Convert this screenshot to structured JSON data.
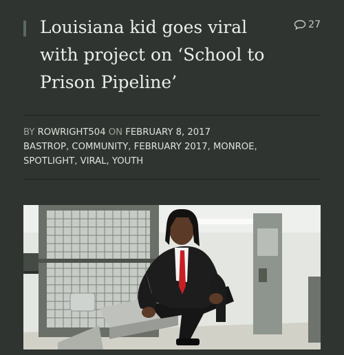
{
  "article": {
    "title": "Louisiana kid goes viral with project on ‘School to Prison Pipeline’",
    "comment_count": "27",
    "comment_icon": "speech-bubble-icon",
    "meta": {
      "by_label": "BY",
      "author": "ROWRIGHT504",
      "on_label": "ON",
      "date": "FEBRUARY 8, 2017",
      "tags": [
        "BASTROP",
        "COMMUNITY",
        "FEBRUARY 2017",
        "MONROE",
        "SPOTLIGHT",
        "VIRAL",
        "YOUTH"
      ]
    }
  },
  "colors": {
    "background": "#2f3430",
    "title_text": "#eceee9",
    "meta_text": "#d8dbd5"
  }
}
